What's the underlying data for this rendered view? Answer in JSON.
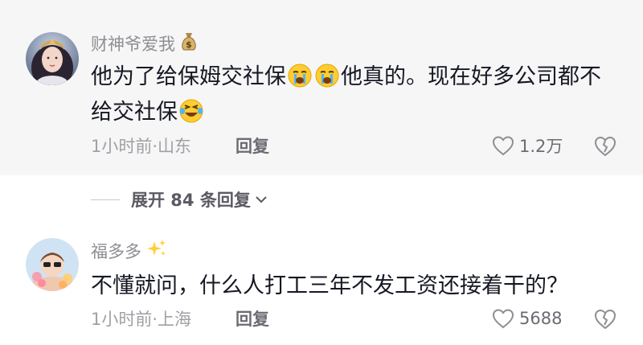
{
  "comments": [
    {
      "username": "财神爷爱我",
      "badge_icon": "money-bag-icon",
      "text_part1": "他为了给保姆交社保",
      "text_part2": "他真的。现在好多公司都不给交社保",
      "time_location": "1小时前·山东",
      "reply_label": "回复",
      "like_count": "1.2万"
    },
    {
      "username": "福多多",
      "badge_icon": "sparkles-icon",
      "text": "不懂就问，什么人打工三年不发工资还接着干的？",
      "time_location": "1小时前·上海",
      "reply_label": "回复",
      "like_count": "5688"
    }
  ],
  "expand_replies": {
    "label": "展开 84 条回复"
  },
  "colors": {
    "background": "#ffffff",
    "highlight_bg": "#f6f6f7",
    "text_primary": "#161823",
    "text_secondary": "#8e8e93"
  }
}
